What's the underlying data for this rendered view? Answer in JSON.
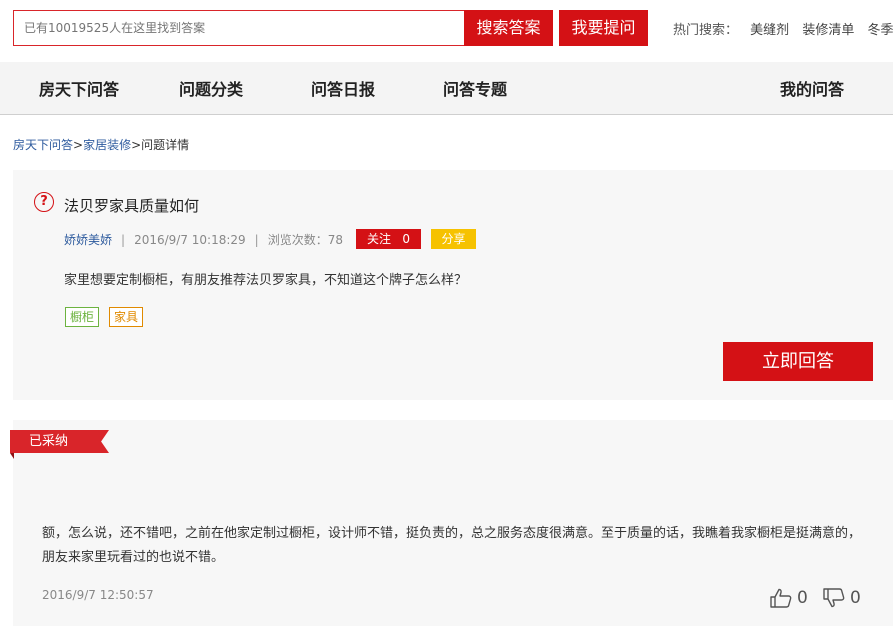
{
  "search": {
    "placeholder": "已有10019525人在这里找到答案",
    "search_label": "搜索答案",
    "ask_label": "我要提问"
  },
  "hot": {
    "label": "热门搜索：",
    "items": [
      "美缝剂",
      "装修清单",
      "冬季"
    ]
  },
  "nav": {
    "items": [
      "房天下问答",
      "问题分类",
      "问答日报",
      "问答专题"
    ],
    "my": "我的问答"
  },
  "breadcrumb": {
    "home": "房天下问答",
    "sep": ">",
    "category": "家居装修",
    "current": "问题详情"
  },
  "question": {
    "title": "法贝罗家具质量如何",
    "user": "娇娇美娇",
    "time": "2016/9/7 10:18:29",
    "views_label": "浏览次数：78",
    "follow_label": "关注",
    "follow_count": "0",
    "share_label": "分享",
    "body": "家里想要定制橱柜，有朋友推荐法贝罗家具，不知道这个牌子怎么样？",
    "tags": [
      "橱柜",
      "家具"
    ],
    "answer_now": "立即回答"
  },
  "answer": {
    "badge": "已采纳",
    "body": "额，怎么说，还不错吧，之前在他家定制过橱柜，设计师不错，挺负责的，总之服务态度很满意。至于质量的话，我瞧着我家橱柜是挺满意的，朋友来家里玩看过的也说不错。",
    "time": "2016/9/7 12:50:57",
    "upvotes": "0",
    "downvotes": "0"
  },
  "colors": {
    "accent": "#d41115",
    "share": "#f6c200",
    "link": "#2e5b9e"
  }
}
